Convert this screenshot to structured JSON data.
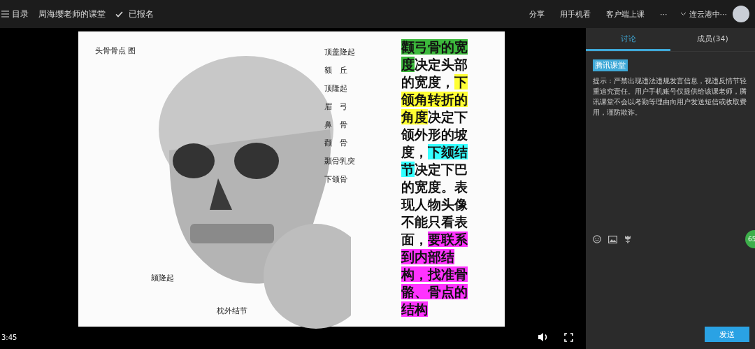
{
  "top_bar": {
    "menu_label": "目录",
    "course_title": "周海缨老师的课堂",
    "enrolled_label": "已报名",
    "actions": [
      "分享",
      "用手机看",
      "客户端上课",
      "···"
    ],
    "user_name": "连云港中···"
  },
  "slide": {
    "figure_title": "头骨骨点 图",
    "side_labels": [
      "顶盖隆起",
      "额　丘",
      "顶隆起",
      "眉　弓",
      "鼻　骨",
      "颧　骨",
      "颞骨乳突",
      "下颌骨"
    ],
    "bottom_labels": [
      "颏隆起",
      "枕外结节"
    ],
    "text_segments": [
      {
        "text": "颧弓骨的宽度",
        "color": "#3cb83c"
      },
      {
        "text": "决定头部的宽度，"
      },
      {
        "text": "下颌角转折的角度",
        "color": "#ffff33"
      },
      {
        "text": "决定下颌外形的坡度，"
      },
      {
        "text": "下颏结节",
        "color": "#33ffff"
      },
      {
        "text": "决定下巴的宽度。表现人物头像不能只看表面，"
      },
      {
        "text": "要联系到内部结构，找准骨骼、骨点的结构",
        "color": "#ff33ff"
      }
    ]
  },
  "player": {
    "time": "3:45"
  },
  "chat": {
    "tabs": [
      {
        "label": "讨论",
        "selected": true
      },
      {
        "label": "成员(34)",
        "selected": false
      }
    ],
    "messages": [
      {
        "tag": "腾讯课堂",
        "text": "提示：严禁出现违法违规发言信息，视违反情节轻重追究责任。用户手机账号仅提供给该课老师，腾讯课堂不会以考勤等理由向用户发送短信或收取费用，谨防欺诈。"
      }
    ],
    "online_count": "65",
    "send_label": "发送"
  }
}
